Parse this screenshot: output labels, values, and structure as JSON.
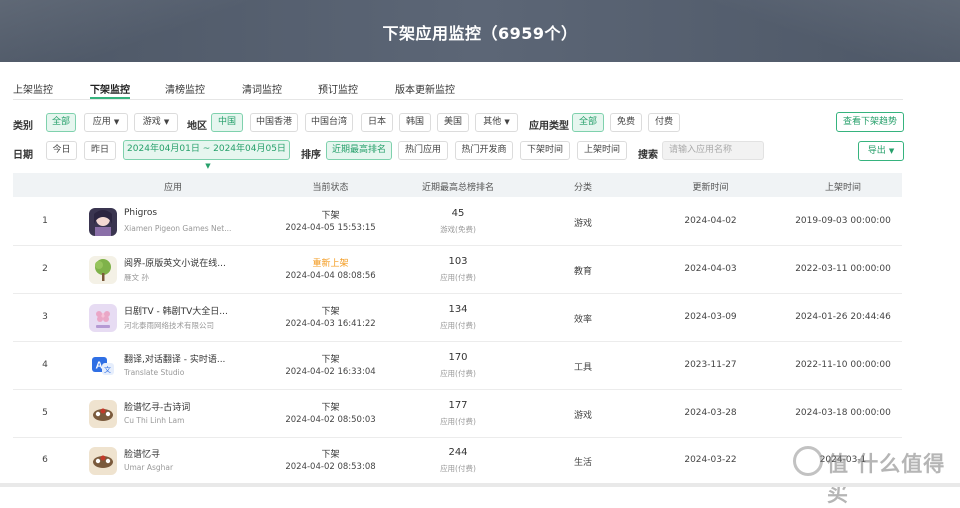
{
  "banner": {
    "title": "下架应用监控（6959个）"
  },
  "tabs": [
    "上架监控",
    "下架监控",
    "清榜监控",
    "清词监控",
    "预订监控",
    "版本更新监控"
  ],
  "filters": {
    "category_label": "类别",
    "category_all": "全部",
    "category_app": "应用",
    "category_game": "游戏",
    "region_label": "地区",
    "regions": [
      "中国",
      "中国香港",
      "中国台湾",
      "日本",
      "韩国",
      "美国"
    ],
    "region_more": "其他",
    "app_type_label": "应用类型",
    "app_types": [
      "全部",
      "免费",
      "付费"
    ],
    "trend_button": "查看下架趋势",
    "date_label": "日期",
    "date_today": "今日",
    "date_yesterday": "昨日",
    "date_range": "2024年04月01日 ~ 2024年04月05日",
    "sort_label": "排序",
    "sorts": [
      "近期最高排名",
      "热门应用",
      "热门开发商",
      "下架时间",
      "上架时间"
    ],
    "search_label": "搜索",
    "search_placeholder": "请输入应用名称",
    "export_button": "导出"
  },
  "table": {
    "headers": [
      "应用",
      "当前状态",
      "近期最高总榜排名",
      "分类",
      "更新时间",
      "上架时间"
    ],
    "rows": [
      {
        "index": "1",
        "name": "Phigros",
        "developer": "Xiamen Pigeon Games Net...",
        "status": "下架",
        "status_time": "2024-04-05 15:53:15",
        "rank": "45",
        "rank_cat": "游戏(免费)",
        "category": "游戏",
        "updated": "2024-04-02",
        "listed": "2019-09-03 00:00:00",
        "icon": "phigros-icon"
      },
      {
        "index": "2",
        "name": "阅界-原版英文小说在线...",
        "developer": "雁文 孙",
        "status": "重新上架",
        "status_time": "2024-04-04 08:08:56",
        "rank": "103",
        "rank_cat": "应用(付费)",
        "category": "教育",
        "updated": "2024-04-03",
        "listed": "2022-03-11 00:00:00",
        "icon": "tree-icon"
      },
      {
        "index": "3",
        "name": "日剧TV - 韩剧TV大全日...",
        "developer": "河北泰雨网络技术有限公司",
        "status": "下架",
        "status_time": "2024-04-03 16:41:22",
        "rank": "134",
        "rank_cat": "应用(付费)",
        "category": "效率",
        "updated": "2024-03-09",
        "listed": "2024-01-26 20:44:46",
        "icon": "flower-icon"
      },
      {
        "index": "4",
        "name": "翻译,对话翻译 - 实时语...",
        "developer": "Translate Studio",
        "status": "下架",
        "status_time": "2024-04-02 16:33:04",
        "rank": "170",
        "rank_cat": "应用(付费)",
        "category": "工具",
        "updated": "2023-11-27",
        "listed": "2022-11-10 00:00:00",
        "icon": "translate-icon"
      },
      {
        "index": "5",
        "name": "脸谱忆寻-古诗词",
        "developer": "Cu Thi Linh Lam",
        "status": "下架",
        "status_time": "2024-04-02 08:50:03",
        "rank": "177",
        "rank_cat": "应用(付费)",
        "category": "游戏",
        "updated": "2024-03-28",
        "listed": "2024-03-18 00:00:00",
        "icon": "mask-icon"
      },
      {
        "index": "6",
        "name": "脸谱忆寻",
        "developer": "Umar Asghar",
        "status": "下架",
        "status_time": "2024-04-02 08:53:08",
        "rank": "244",
        "rank_cat": "应用(付费)",
        "category": "生活",
        "updated": "2024-03-22",
        "listed": "2024-03-1",
        "icon": "mask-icon"
      }
    ]
  },
  "watermark": {
    "text": "值 什么值得买"
  },
  "colors": {
    "accent": "#36b37e",
    "orange": "#f39a1e",
    "banner": "#535d6c"
  }
}
